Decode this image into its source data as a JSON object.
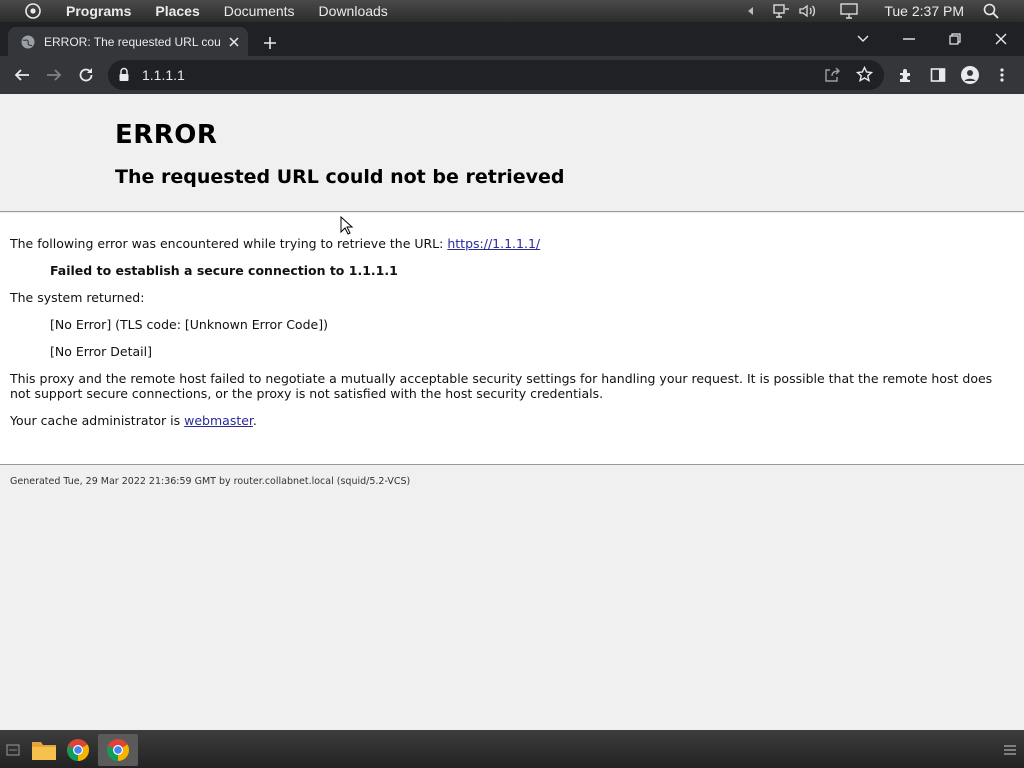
{
  "system_panel": {
    "menu": [
      "Programs",
      "Places",
      "Documents",
      "Downloads"
    ],
    "clock": "Tue 2:37 PM"
  },
  "browser": {
    "tab_title": "ERROR: The requested URL could not be retrieved",
    "address": "1.1.1.1"
  },
  "page": {
    "heading": "ERROR",
    "subheading": "The requested URL could not be retrieved",
    "intro": "The following error was encountered while trying to retrieve the URL:",
    "url_link": "https://1.1.1.1/",
    "error_line": "Failed to establish a secure connection to 1.1.1.1",
    "system_returned": "The system returned:",
    "tls_line": "[No Error] (TLS code: [Unknown Error Code])",
    "detail_line": "[No Error Detail]",
    "explanation": "This proxy and the remote host failed to negotiate a mutually acceptable security settings for handling your request. It is possible that the remote host does not support secure connections, or the proxy is not satisfied with the host security credentials.",
    "admin_prefix": "Your cache administrator is",
    "admin_link": "webmaster",
    "admin_suffix": ".",
    "footer": "Generated Tue, 29 Mar 2022 21:36:59 GMT by router.collabnet.local (squid/5.2-VCS)"
  },
  "colors": {
    "tab_strip": "#202124",
    "toolbar": "#35363a",
    "page_bg": "#f0f0f0",
    "link": "#2a2a99"
  }
}
